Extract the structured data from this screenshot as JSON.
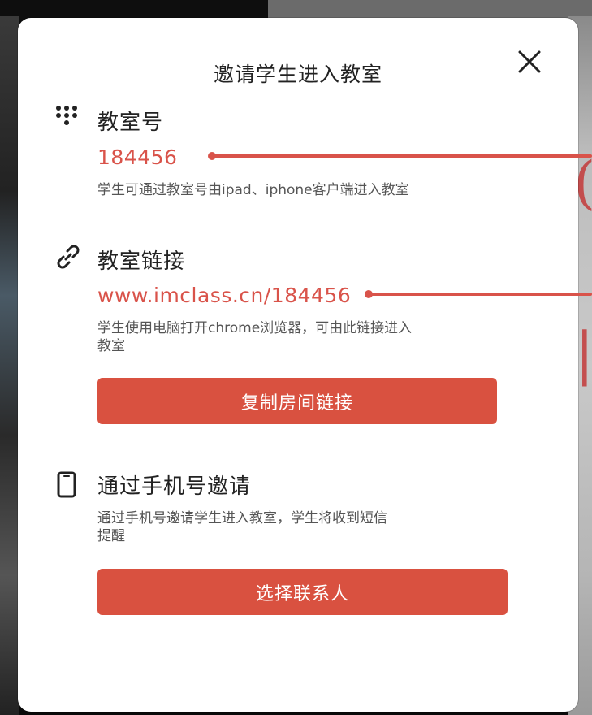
{
  "dialog": {
    "title": "邀请学生进入教室",
    "close_icon": "close-icon"
  },
  "room_number": {
    "icon": "keypad-icon",
    "label": "教室号",
    "value": "184456",
    "description": "学生可通过教室号由ipad、iphone客户端进入教室"
  },
  "room_link": {
    "icon": "link-icon",
    "label": "教室链接",
    "value": "www.imclass.cn/184456",
    "description_line1": "学生使用电脑打开chrome浏览器，可由此链接进入",
    "description_line2": "教室",
    "copy_button": "复制房间链接"
  },
  "phone_invite": {
    "icon": "phone-icon",
    "label": "通过手机号邀请",
    "description_line1": "通过手机号邀请学生进入教室，学生将收到短信",
    "description_line2": "提醒",
    "select_button": "选择联系人"
  },
  "colors": {
    "accent": "#d95140",
    "value_text": "#d9534a",
    "title_text": "#222222",
    "desc_text": "#555555"
  }
}
